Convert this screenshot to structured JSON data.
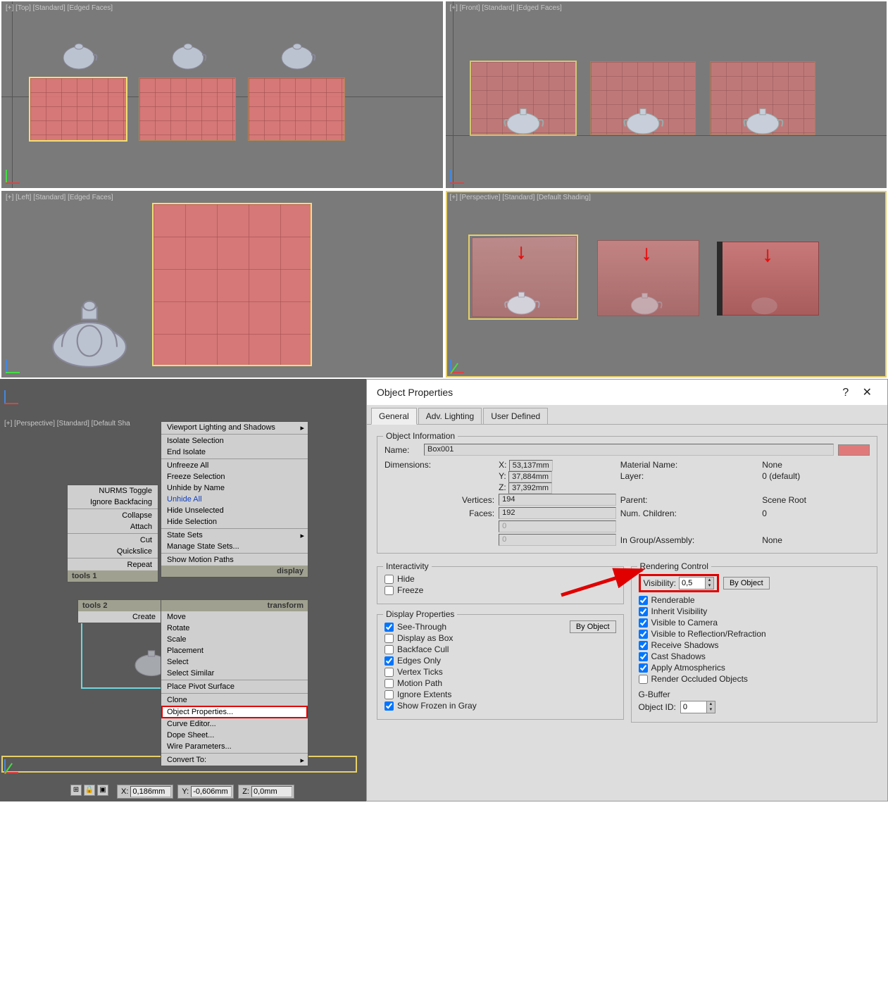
{
  "viewports": {
    "top": "[+] [Top] [Standard] [Edged Faces]",
    "front": "[+] [Front] [Standard] [Edged Faces]",
    "left": "[+] [Left] [Standard] [Edged Faces]",
    "perspective": "[+] [Perspective] [Standard] [Default Shading]",
    "perspective2": "[+] [Perspective] [Standard] [Default Sha"
  },
  "ctx1": {
    "header_l": "tools 1",
    "header_r": "display",
    "items_left": [
      "NURMS Toggle",
      "Ignore Backfacing",
      "Collapse",
      "Attach",
      "Cut",
      "Quickslice",
      "Repeat"
    ],
    "items_right": [
      "Viewport Lighting and Shadows",
      "Isolate Selection",
      "End Isolate",
      "Unfreeze All",
      "Freeze Selection",
      "Unhide by Name",
      "Unhide All",
      "Hide Unselected",
      "Hide Selection",
      "State Sets",
      "Manage State Sets...",
      "Show Motion Paths"
    ]
  },
  "ctx2": {
    "header_l": "tools 2",
    "header_r": "transform",
    "left": [
      "Create"
    ],
    "right": [
      "Move",
      "Rotate",
      "Scale",
      "Placement",
      "Select",
      "Select Similar",
      "Place Pivot Surface",
      "Clone",
      "Object Properties...",
      "Curve Editor...",
      "Dope Sheet...",
      "Wire Parameters...",
      "Convert To:"
    ]
  },
  "coords": {
    "x_label": "X:",
    "x": "0,186mm",
    "y_label": "Y:",
    "y": "-0,606mm",
    "z_label": "Z:",
    "z": "0,0mm"
  },
  "dialog": {
    "title": "Object Properties",
    "help": "?",
    "close": "✕",
    "tabs": [
      "General",
      "Adv. Lighting",
      "User Defined"
    ],
    "obj_info": {
      "title": "Object Information",
      "name_label": "Name:",
      "name": "Box001",
      "dim_label": "Dimensions:",
      "x_label": "X:",
      "x": "53,137mm",
      "y_label": "Y:",
      "y": "37,884mm",
      "z_label": "Z:",
      "z": "37,392mm",
      "mat_label": "Material Name:",
      "mat": "None",
      "layer_label": "Layer:",
      "layer": "0 (default)",
      "vert_label": "Vertices:",
      "vert": "194",
      "faces_label": "Faces:",
      "faces": "192",
      "blank1": "0",
      "blank2": "0",
      "parent_label": "Parent:",
      "parent": "Scene Root",
      "child_label": "Num. Children:",
      "child": "0",
      "group_label": "In Group/Assembly:",
      "group": "None"
    },
    "interactivity": {
      "title": "Interactivity",
      "hide": "Hide",
      "freeze": "Freeze"
    },
    "display": {
      "title": "Display Properties",
      "by_object": "By Object",
      "opts": [
        "See-Through",
        "Display as Box",
        "Backface Cull",
        "Edges Only",
        "Vertex Ticks",
        "Motion Path",
        "Ignore Extents",
        "Show Frozen in Gray"
      ],
      "checked": [
        true,
        false,
        false,
        true,
        false,
        false,
        false,
        true
      ]
    },
    "render": {
      "title": "Rendering Control",
      "vis_label": "Visibility:",
      "vis": "0,5",
      "by_object": "By Object",
      "opts": [
        "Renderable",
        "Inherit Visibility",
        "Visible to Camera",
        "Visible to Reflection/Refraction",
        "Receive Shadows",
        "Cast Shadows",
        "Apply Atmospherics",
        "Render Occluded Objects"
      ],
      "checked": [
        true,
        true,
        true,
        true,
        true,
        true,
        true,
        false
      ]
    },
    "gbuf": {
      "title": "G-Buffer",
      "label": "Object ID:",
      "val": "0"
    }
  }
}
